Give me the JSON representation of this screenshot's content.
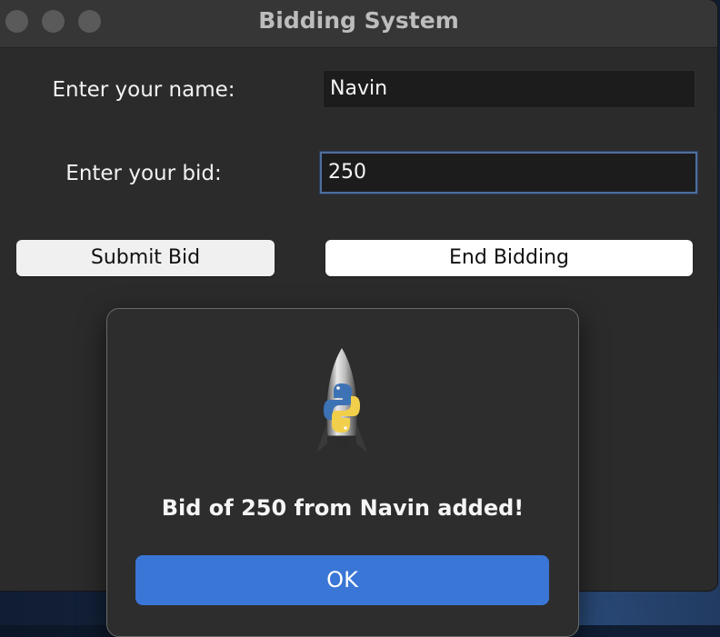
{
  "window": {
    "title": "Bidding System"
  },
  "form": {
    "name_label": "Enter your name:",
    "name_value": "Navin",
    "bid_label": "Enter your bid:",
    "bid_value": "250",
    "submit_label": "Submit Bid",
    "end_label": "End Bidding"
  },
  "dialog": {
    "icon": "python-launcher-rocket-icon",
    "message": "Bid of 250 from Navin added!",
    "ok_label": "OK"
  },
  "colors": {
    "accent": "#3a76d6",
    "window_bg": "#2b2b2b",
    "input_bg": "#1c1c1c",
    "focus_ring": "#4f6e9c"
  }
}
